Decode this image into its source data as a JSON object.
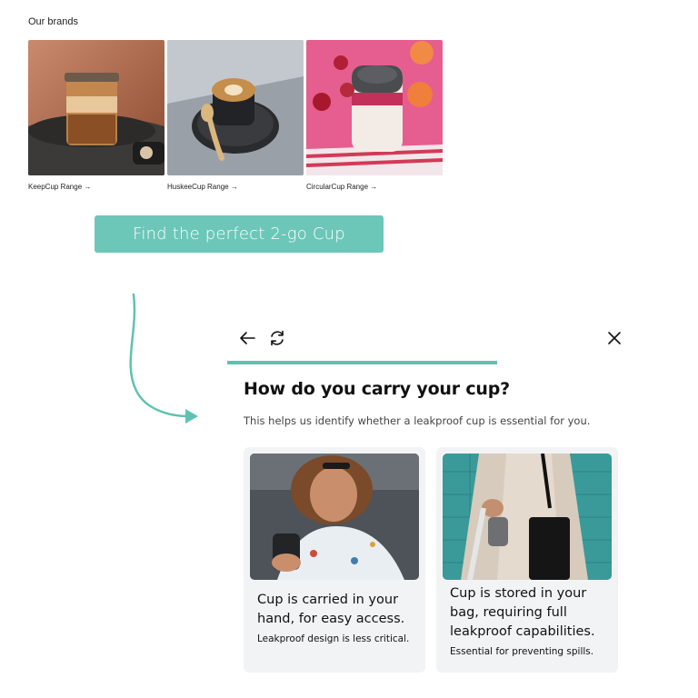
{
  "brands": {
    "heading": "Our brands",
    "items": [
      {
        "link": "KeepCup Range →"
      },
      {
        "link": "HuskeeCup Range →"
      },
      {
        "link": "CircularCup Range →"
      }
    ]
  },
  "cta": {
    "label": "Find the perfect 2-go Cup"
  },
  "quiz": {
    "title": "How do you carry your cup?",
    "subtitle": "This helps us identify whether a leakproof cup is essential for you.",
    "options": [
      {
        "line1": "Cup is carried in your",
        "line2": "hand, for easy access.",
        "note": "Leakproof design is less critical."
      },
      {
        "line1": "Cup is stored in your",
        "line2": "bag, requiring full",
        "line3": "leakproof capabilities.",
        "note": "Essential for preventing spills."
      }
    ]
  },
  "colors": {
    "accent": "#6cc7b8",
    "progress": "#5fc2b1",
    "card_bg": "#f2f3f5"
  },
  "icons": [
    "arrow-left-icon",
    "refresh-icon",
    "close-icon",
    "curved-arrow-icon"
  ]
}
